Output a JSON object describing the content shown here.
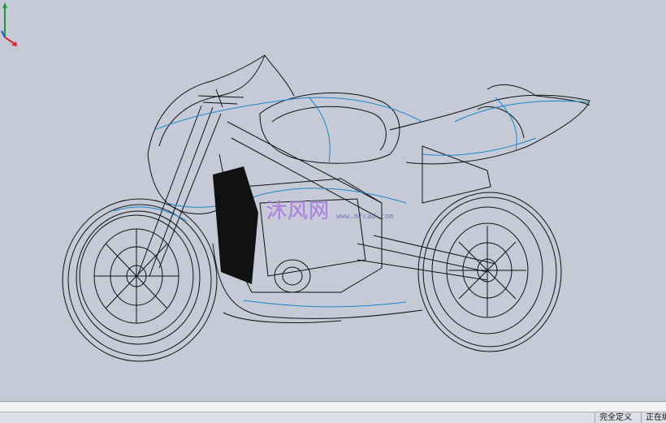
{
  "viewport": {
    "watermark_text": "沐风网",
    "watermark_url": "www.mfcad.com"
  },
  "triad": {
    "x_color": "#d8262d",
    "y_color": "#1f9b35",
    "z_color": "#2a55c8"
  },
  "status_bar": {
    "definition_status": "完全定义",
    "edit_status": "正在编"
  },
  "colors": {
    "wireframe_black": "#111111",
    "wireframe_blue": "#1a86c8",
    "viewport_bg": "#c6cad7"
  }
}
